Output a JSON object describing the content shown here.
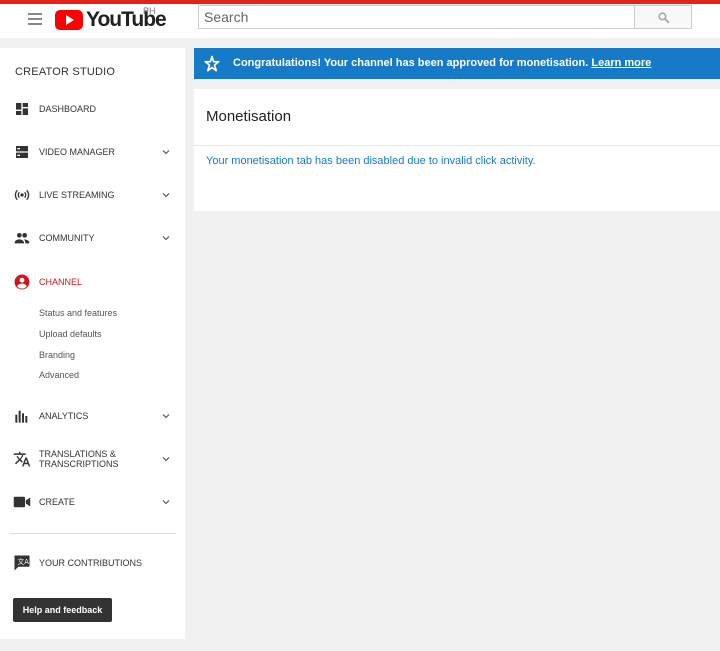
{
  "header": {
    "logo_text": "YouTube",
    "region": "PH",
    "search_placeholder": "Search"
  },
  "sidebar": {
    "title": "CREATOR STUDIO",
    "items": [
      {
        "label": "DASHBOARD",
        "icon": "dashboard-icon",
        "expandable": false
      },
      {
        "label": "VIDEO MANAGER",
        "icon": "video-manager-icon",
        "expandable": true
      },
      {
        "label": "LIVE STREAMING",
        "icon": "live-streaming-icon",
        "expandable": true
      },
      {
        "label": "COMMUNITY",
        "icon": "community-icon",
        "expandable": true
      },
      {
        "label": "CHANNEL",
        "icon": "channel-icon",
        "expandable": false,
        "active": true
      },
      {
        "label": "ANALYTICS",
        "icon": "analytics-icon",
        "expandable": true
      },
      {
        "label": "TRANSLATIONS &",
        "label2": "TRANSCRIPTIONS",
        "icon": "translate-icon",
        "expandable": true
      },
      {
        "label": "CREATE",
        "icon": "create-icon",
        "expandable": true
      },
      {
        "label": "YOUR CONTRIBUTIONS",
        "icon": "contributions-icon",
        "expandable": false
      }
    ],
    "channel_subitems": [
      "Status and features",
      "Upload defaults",
      "Branding",
      "Advanced"
    ],
    "help_label": "Help and feedback"
  },
  "banner": {
    "message": "Congratulations! Your channel has been approved for monetisation.",
    "link": "Learn more"
  },
  "card": {
    "title": "Monetisation",
    "message": "Your monetisation tab has been disabled due to invalid click activity."
  },
  "colors": {
    "accent_red": "#e62117",
    "banner_blue": "#167ac6",
    "active_red": "#cc181e"
  }
}
